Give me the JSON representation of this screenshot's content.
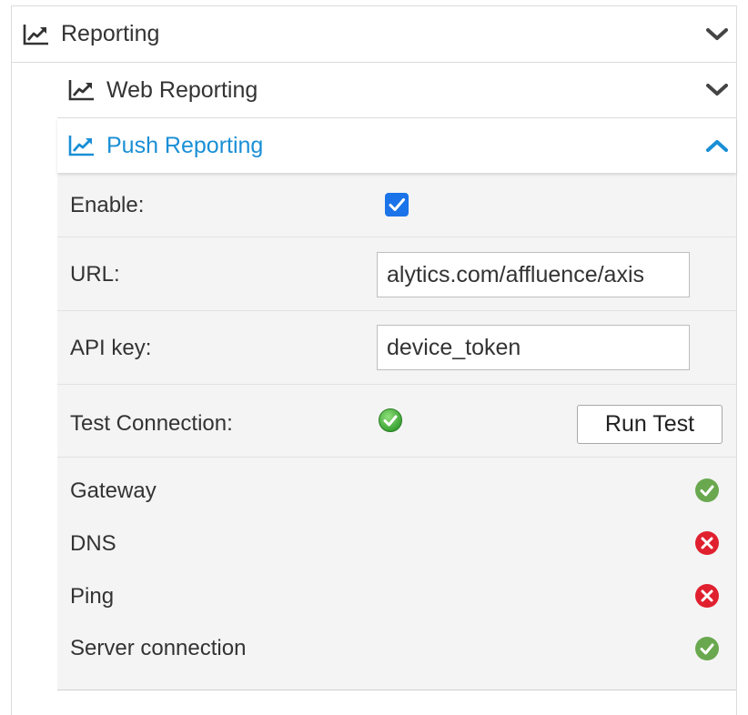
{
  "reporting": {
    "title": "Reporting",
    "icon": "line-chart-icon",
    "expanded": true
  },
  "web_reporting": {
    "title": "Web Reporting",
    "icon": "line-chart-icon",
    "expanded": false
  },
  "push_reporting": {
    "title": "Push Reporting",
    "icon": "line-chart-icon",
    "expanded": true,
    "enable_label": "Enable:",
    "enabled": true,
    "url_label": "URL:",
    "url_value": "alytics.com/affluence/axis",
    "api_key_label": "API key:",
    "api_key_value": "device_token",
    "test_connection_label": "Test Connection:",
    "test_status": "ok",
    "run_test_label": "Run Test"
  },
  "diagnostics": [
    {
      "label": "Gateway",
      "status": "ok"
    },
    {
      "label": "DNS",
      "status": "error"
    },
    {
      "label": "Ping",
      "status": "error"
    },
    {
      "label": "Server connection",
      "status": "ok"
    }
  ],
  "colors": {
    "accent": "#1a8fd6",
    "checkbox": "#1a73e8",
    "ok": "#6aa84f",
    "error": "#e0202f",
    "content_bg": "#f4f4f4"
  }
}
